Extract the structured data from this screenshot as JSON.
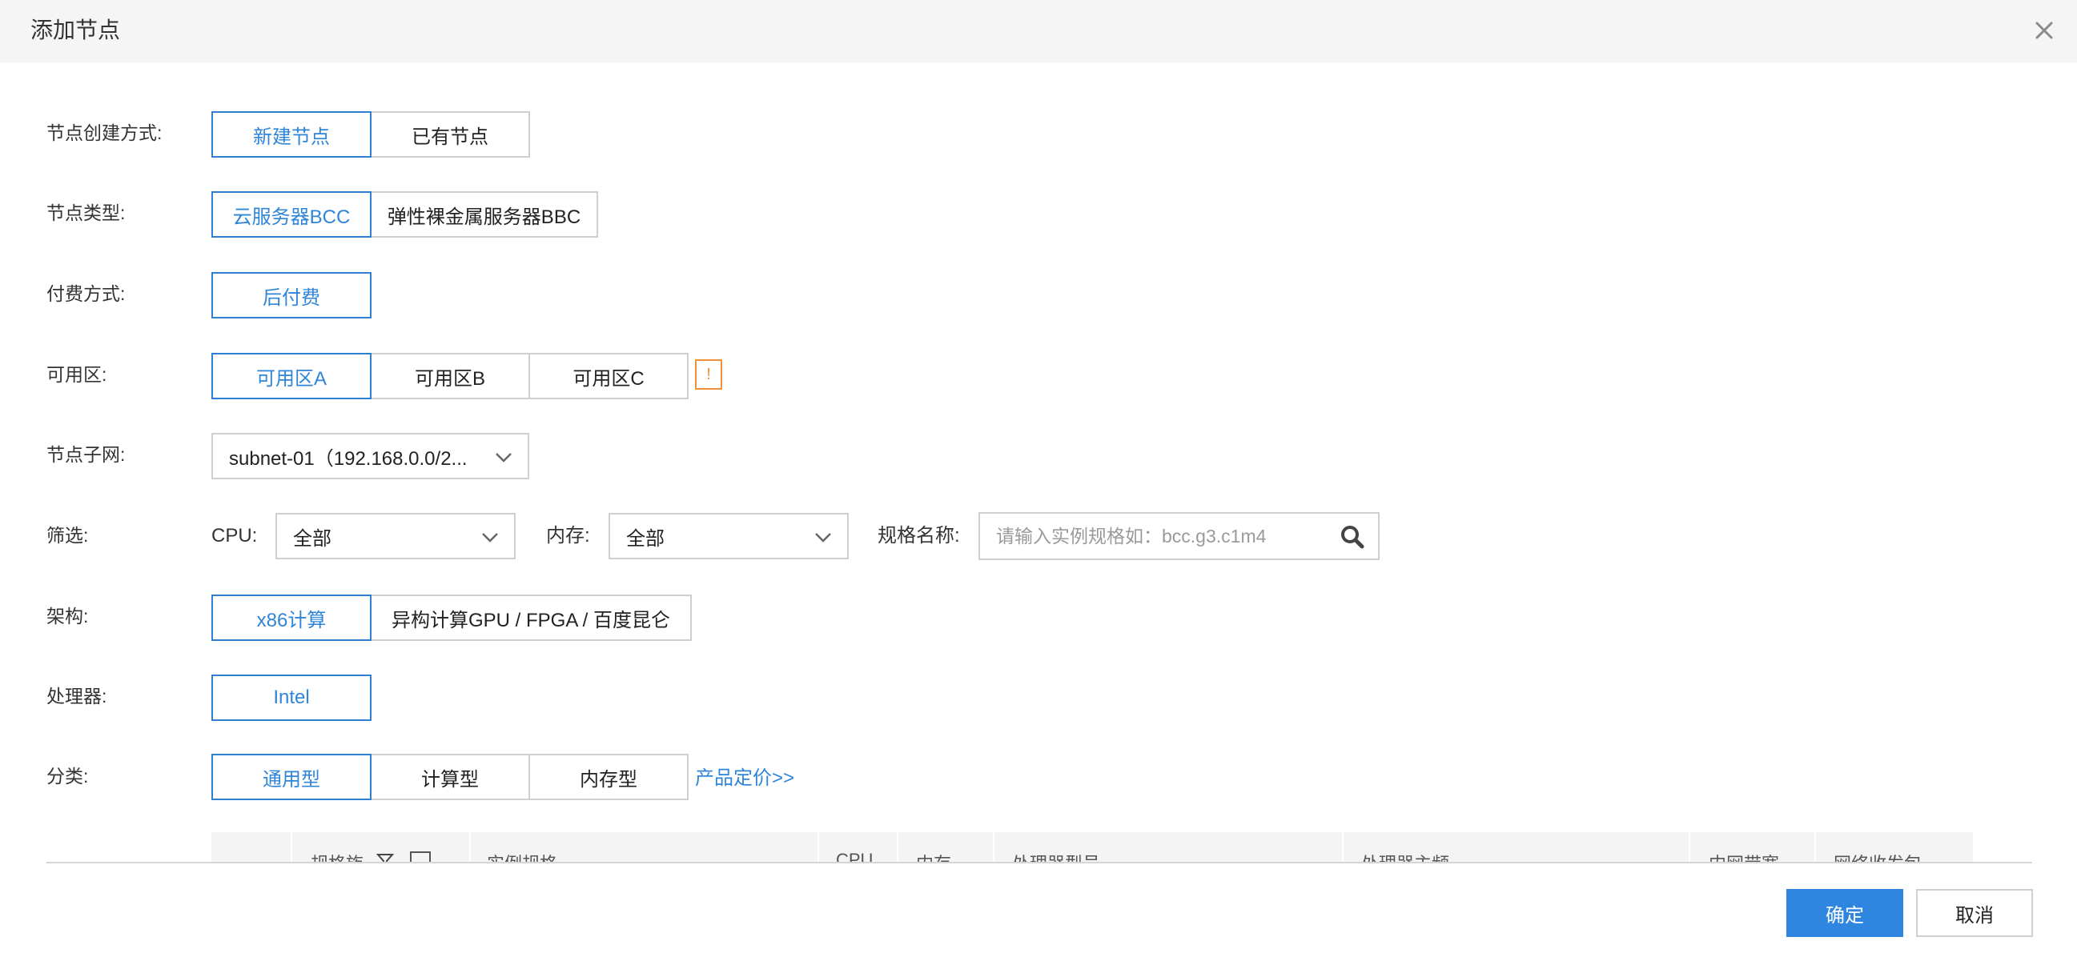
{
  "dialog": {
    "title": "添加节点"
  },
  "rows": {
    "create_mode": {
      "label": "节点创建方式:",
      "options": [
        "新建节点",
        "已有节点"
      ]
    },
    "node_type": {
      "label": "节点类型:",
      "options": [
        "云服务器BCC",
        "弹性裸金属服务器BBC"
      ]
    },
    "billing": {
      "label": "付费方式:",
      "options": [
        "后付费"
      ]
    },
    "zone": {
      "label": "可用区:",
      "options": [
        "可用区A",
        "可用区B",
        "可用区C"
      ],
      "warn": "!"
    },
    "subnet": {
      "label": "节点子网:",
      "value": "subnet-01（192.168.0.0/2..."
    },
    "filter": {
      "label": "筛选:",
      "cpu_label": "CPU:",
      "cpu_value": "全部",
      "mem_label": "内存:",
      "mem_value": "全部",
      "spec_label": "规格名称:",
      "spec_placeholder": "请输入实例规格如：bcc.g3.c1m4"
    },
    "arch": {
      "label": "架构:",
      "options": [
        "x86计算",
        "异构计算GPU / FPGA / 百度昆仑"
      ]
    },
    "processor": {
      "label": "处理器:",
      "options": [
        "Intel"
      ]
    },
    "category": {
      "label": "分类:",
      "options": [
        "通用型",
        "计算型",
        "内存型"
      ],
      "link": "产品定价>>"
    }
  },
  "table": {
    "headers": [
      "规格族",
      "实例规格",
      "CPU",
      "内存",
      "处理器型号",
      "处理器主频",
      "内网带宽",
      "网络收发包"
    ]
  },
  "footer": {
    "confirm": "确定",
    "cancel": "取消"
  },
  "colors": {
    "accent": "#2f85d8",
    "primary_button": "#2f86e0",
    "warning": "#f0913a",
    "header_bg": "#f5f5f5"
  }
}
